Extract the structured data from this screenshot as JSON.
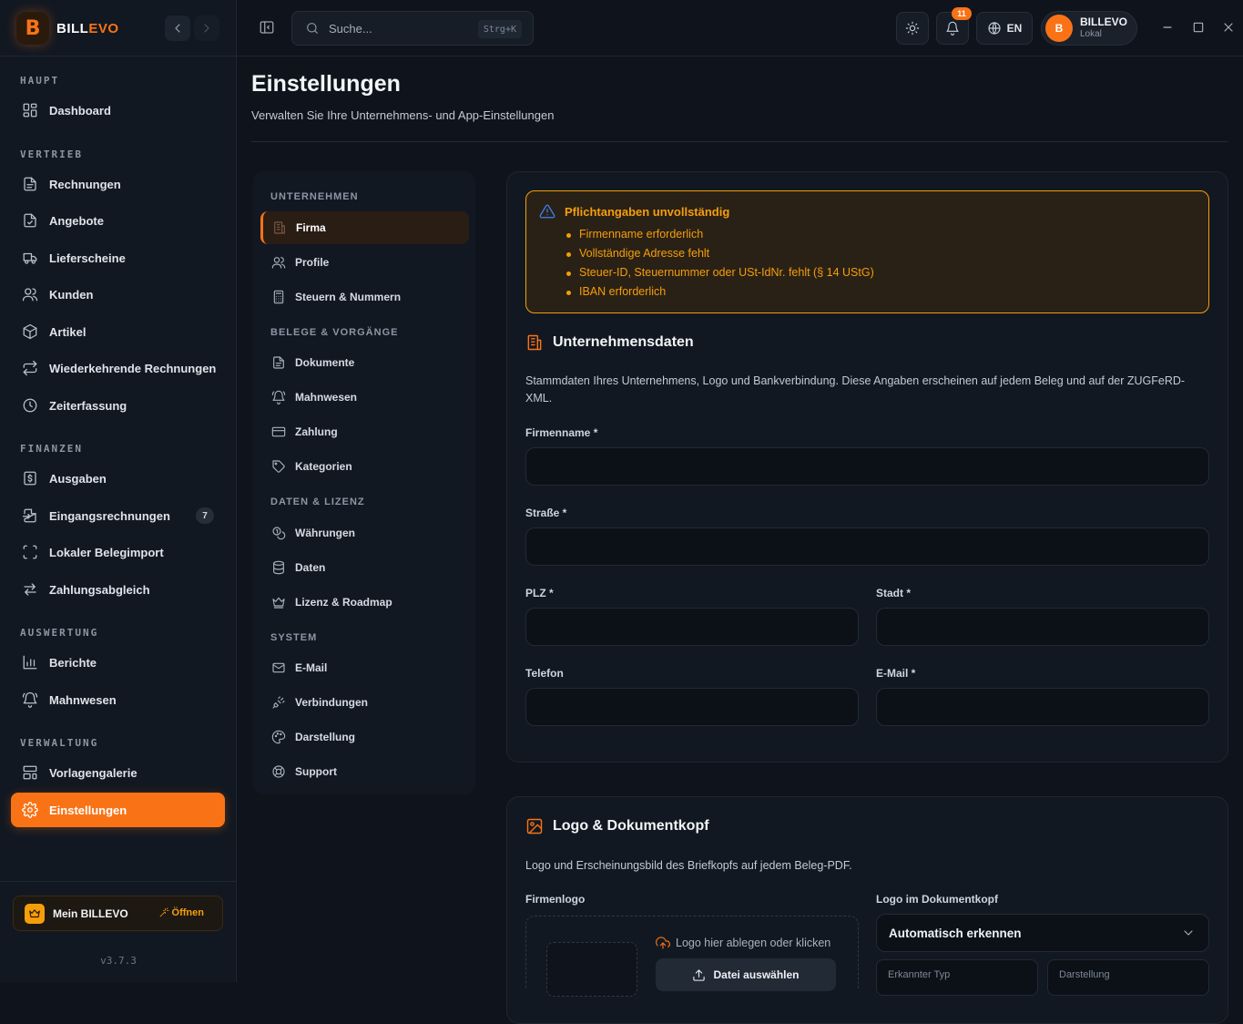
{
  "app": {
    "brand_first": "BILL",
    "brand_second": "EVO",
    "logo_letter": "B",
    "accent": "#f97316",
    "version": "v3.7.3"
  },
  "sidebar": {
    "sections": {
      "haupt": "HAUPT",
      "vertrieb": "VERTRIEB",
      "finanzen": "FINANZEN",
      "auswertung": "AUSWERTUNG",
      "verwaltung": "VERWALTUNG"
    },
    "items": {
      "dashboard": "Dashboard",
      "rechnungen": "Rechnungen",
      "angebote": "Angebote",
      "lieferscheine": "Lieferscheine",
      "kunden": "Kunden",
      "artikel": "Artikel",
      "wiederkehrend": "Wiederkehrende Rechnungen",
      "zeiterfassung": "Zeiterfassung",
      "ausgaben": "Ausgaben",
      "eingangsrechnungen": "Eingangsrechnungen",
      "belegimport": "Lokaler Belegimport",
      "zahlungsabgleich": "Zahlungsabgleich",
      "berichte": "Berichte",
      "mahnwesen": "Mahnwesen",
      "vorlagengalerie": "Vorlagengalerie",
      "einstellungen": "Einstellungen"
    },
    "eingangsrechnungen_count": "7",
    "mein_label": "Mein BILLEVO",
    "mein_open": "Öffnen"
  },
  "topbar": {
    "search_placeholder": "Suche...",
    "search_shortcut": "Strg+K",
    "notification_count": "11",
    "language": "EN",
    "user_initial": "B",
    "user_name": "BILLEVO",
    "user_sub": "Lokal"
  },
  "page": {
    "title": "Einstellungen",
    "subtitle": "Verwalten Sie Ihre Unternehmens- und App-Einstellungen"
  },
  "settings_nav": {
    "groups": {
      "unternehmen": "UNTERNEHMEN",
      "belege": "BELEGE & VORGÄNGE",
      "daten": "DATEN & LIZENZ",
      "system": "SYSTEM"
    },
    "items": {
      "firma": "Firma",
      "profile": "Profile",
      "steuern": "Steuern & Nummern",
      "dokumente": "Dokumente",
      "mahnwesen": "Mahnwesen",
      "zahlung": "Zahlung",
      "kategorien": "Kategorien",
      "waehrungen": "Währungen",
      "daten": "Daten",
      "lizenz": "Lizenz & Roadmap",
      "email": "E-Mail",
      "verbindungen": "Verbindungen",
      "darstellung": "Darstellung",
      "support": "Support"
    }
  },
  "alert": {
    "title": "Pflichtangaben unvollständig",
    "items": [
      "Firmenname erforderlich",
      "Vollständige Adresse fehlt",
      "Steuer-ID, Steuernummer oder USt-IdNr. fehlt (§ 14 UStG)",
      "IBAN erforderlich"
    ]
  },
  "company": {
    "title": "Unternehmensdaten",
    "description": "Stammdaten Ihres Unternehmens, Logo und Bankverbindung. Diese Angaben erscheinen auf jedem Beleg und auf der ZUGFeRD-XML.",
    "fields": {
      "firmenname": {
        "label": "Firmenname *",
        "value": ""
      },
      "strasse": {
        "label": "Straße *",
        "value": ""
      },
      "plz": {
        "label": "PLZ *",
        "value": ""
      },
      "stadt": {
        "label": "Stadt *",
        "value": ""
      },
      "telefon": {
        "label": "Telefon",
        "value": ""
      },
      "email": {
        "label": "E-Mail *",
        "value": ""
      }
    }
  },
  "logo": {
    "title": "Logo & Dokumentkopf",
    "description": "Logo und Erscheinungsbild des Briefkopfs auf jedem Beleg-PDF.",
    "firmenlogo_label": "Firmenlogo",
    "drop_hint": "Logo hier ablegen oder klicken",
    "file_button": "Datei auswählen",
    "header_label": "Logo im Dokumentkopf",
    "header_value": "Automatisch erkennen",
    "detected_type_label": "Erkannter Typ",
    "display_label": "Darstellung"
  }
}
